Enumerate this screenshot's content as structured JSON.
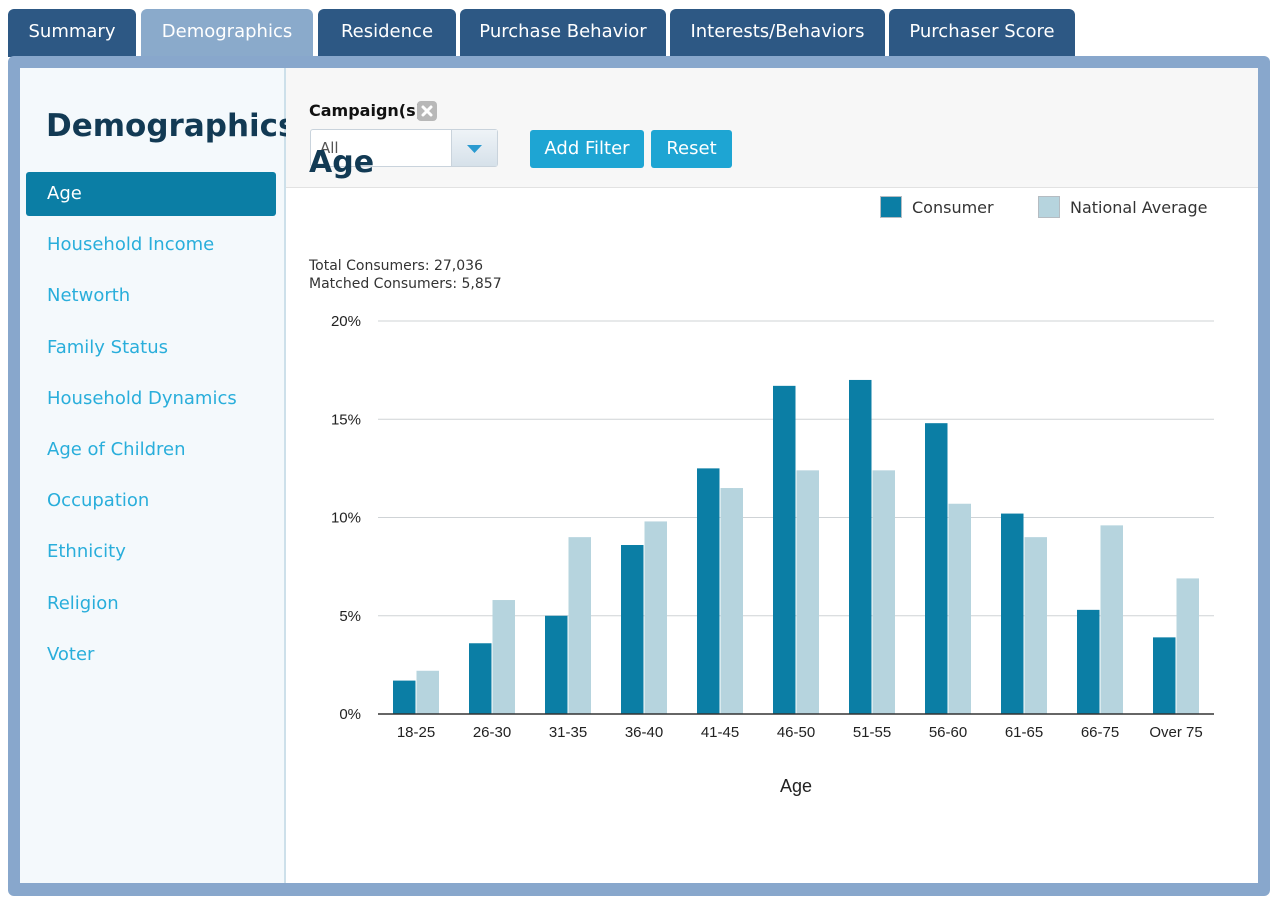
{
  "tabs": [
    {
      "label": "Summary",
      "active": false
    },
    {
      "label": "Demographics",
      "active": true
    },
    {
      "label": "Residence",
      "active": false
    },
    {
      "label": "Purchase Behavior",
      "active": false
    },
    {
      "label": "Interests/Behaviors",
      "active": false
    },
    {
      "label": "Purchaser Score",
      "active": false
    }
  ],
  "sidebar": {
    "title": "Demographics",
    "items": [
      {
        "label": "Age",
        "active": true
      },
      {
        "label": "Household Income",
        "active": false
      },
      {
        "label": "Networth",
        "active": false
      },
      {
        "label": "Family Status",
        "active": false
      },
      {
        "label": "Household Dynamics",
        "active": false
      },
      {
        "label": "Age of Children",
        "active": false
      },
      {
        "label": "Occupation",
        "active": false
      },
      {
        "label": "Ethnicity",
        "active": false
      },
      {
        "label": "Religion",
        "active": false
      },
      {
        "label": "Voter",
        "active": false
      }
    ]
  },
  "filters": {
    "label": "Campaign(s)",
    "clear_icon": "close-x-icon",
    "campaign_select": {
      "value": "All"
    },
    "add_filter_label": "Add Filter",
    "reset_label": "Reset"
  },
  "stats": {
    "total": "Total Consumers: 27,036",
    "matched": "Matched Consumers: 5,857"
  },
  "colors": {
    "tab": "#2d5884",
    "tab_active": "#8aaacb",
    "frame": "#88a7cc",
    "accent": "#1ea5d3",
    "sidebar_link": "#29aedb",
    "title": "#123a54"
  },
  "chart_data": {
    "type": "bar",
    "title": "Age",
    "xlabel": "Age",
    "ylabel": "",
    "ylim": [
      0,
      20
    ],
    "yticks": [
      "0%",
      "5%",
      "10%",
      "15%",
      "20%"
    ],
    "grid": true,
    "legend_position": "top-right",
    "categories": [
      "18-25",
      "26-30",
      "31-35",
      "36-40",
      "41-45",
      "46-50",
      "51-55",
      "56-60",
      "61-65",
      "66-75",
      "Over 75"
    ],
    "series": [
      {
        "name": "Consumer",
        "color": "#0b7ea5",
        "values": [
          1.7,
          3.6,
          5.0,
          8.6,
          12.5,
          16.7,
          17.0,
          14.8,
          10.2,
          5.3,
          3.9
        ]
      },
      {
        "name": "National Average",
        "color": "#b6d4de",
        "values": [
          2.2,
          5.8,
          9.0,
          9.8,
          11.5,
          12.4,
          12.4,
          10.7,
          9.0,
          9.6,
          6.9
        ]
      }
    ]
  }
}
